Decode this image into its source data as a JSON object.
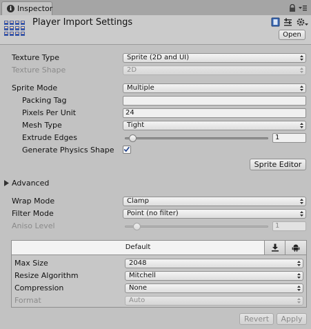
{
  "window": {
    "tab_title": "Inspector",
    "tab_icon": "info-icon",
    "lock_icon": "lock-icon",
    "menu_icon": "panel-menu-icon"
  },
  "header": {
    "title": "Player Import Settings",
    "open_label": "Open",
    "icons": [
      "help-book-icon",
      "preset-sliders-icon",
      "gear-icon"
    ]
  },
  "texture": {
    "type_label": "Texture Type",
    "type_value": "Sprite (2D and UI)",
    "shape_label": "Texture Shape",
    "shape_value": "2D"
  },
  "sprite": {
    "mode_label": "Sprite Mode",
    "mode_value": "Multiple",
    "packing_tag_label": "Packing Tag",
    "packing_tag_value": "",
    "ppu_label": "Pixels Per Unit",
    "ppu_value": "24",
    "mesh_type_label": "Mesh Type",
    "mesh_type_value": "Tight",
    "extrude_label": "Extrude Edges",
    "extrude_value": "1",
    "extrude_min": 0,
    "extrude_max": 32,
    "physics_shape_label": "Generate Physics Shape",
    "physics_shape_checked": true,
    "editor_button": "Sprite Editor"
  },
  "advanced": {
    "label": "Advanced",
    "expanded": false
  },
  "wrap": {
    "wrap_mode_label": "Wrap Mode",
    "wrap_mode_value": "Clamp",
    "filter_mode_label": "Filter Mode",
    "filter_mode_value": "Point (no filter)",
    "aniso_label": "Aniso Level",
    "aniso_value": "1",
    "aniso_min": 0,
    "aniso_max": 16
  },
  "platform": {
    "default_tab": "Default",
    "tab_icons": [
      "download-icon",
      "android-icon"
    ],
    "max_size_label": "Max Size",
    "max_size_value": "2048",
    "resize_label": "Resize Algorithm",
    "resize_value": "Mitchell",
    "compression_label": "Compression",
    "compression_value": "None",
    "format_label": "Format",
    "format_value": "Auto"
  },
  "footer": {
    "revert_label": "Revert",
    "apply_label": "Apply"
  },
  "colors": {
    "background": "#c2c2c2",
    "tab_strip": "#a5a5a5",
    "disabled_text": "#8a8a8a",
    "checkbox_check": "#1d3f8a"
  }
}
